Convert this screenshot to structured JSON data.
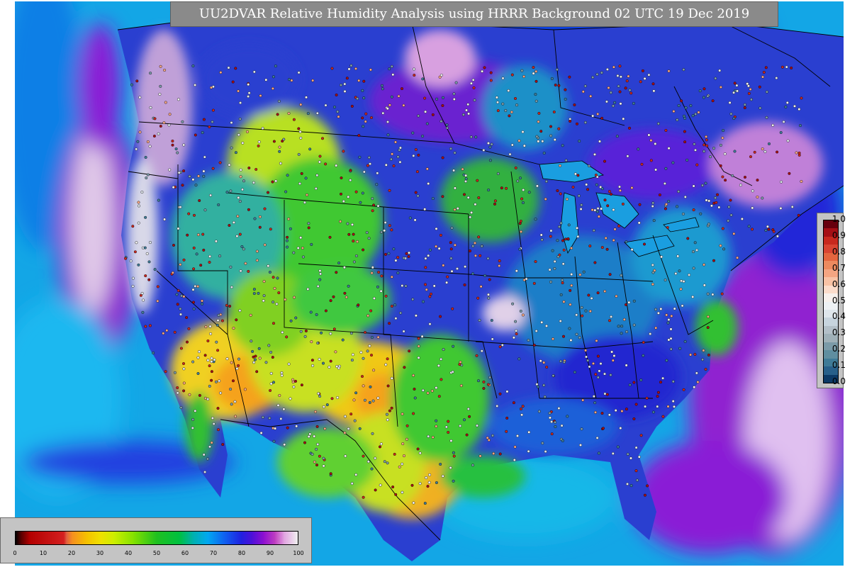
{
  "title": "UU2DVAR Relative Humidity Analysis using HRRR Background 02 UTC 19 Dec 2019",
  "colors": {
    "ocean": "#13a6e6",
    "land_wet": "#2a3fd0",
    "land_mid": "#1fc21f",
    "land_dry": "#f0e020",
    "land_very_dry": "#f5a21a",
    "moist_purple": "#8a1bd6",
    "cloud_white": "#e8e8e8",
    "border": "#000000"
  },
  "relative_humidity_colorbar": {
    "ticks": [
      "0",
      "10",
      "20",
      "30",
      "40",
      "50",
      "60",
      "70",
      "80",
      "90",
      "100"
    ],
    "stops": [
      {
        "value": 0,
        "color": "#000000"
      },
      {
        "value": 2,
        "color": "#5a0000"
      },
      {
        "value": 5,
        "color": "#b30000"
      },
      {
        "value": 17,
        "color": "#d42020"
      },
      {
        "value": 18,
        "color": "#e06040"
      },
      {
        "value": 20,
        "color": "#f59020"
      },
      {
        "value": 25,
        "color": "#f5c000"
      },
      {
        "value": 30,
        "color": "#f0e000"
      },
      {
        "value": 35,
        "color": "#ccee00"
      },
      {
        "value": 42,
        "color": "#80e000"
      },
      {
        "value": 50,
        "color": "#20c020"
      },
      {
        "value": 58,
        "color": "#00c040"
      },
      {
        "value": 63,
        "color": "#00b0b0"
      },
      {
        "value": 68,
        "color": "#00a8f0"
      },
      {
        "value": 74,
        "color": "#1060f0"
      },
      {
        "value": 80,
        "color": "#2020e0"
      },
      {
        "value": 84,
        "color": "#5010d8"
      },
      {
        "value": 88,
        "color": "#9010d0"
      },
      {
        "value": 92,
        "color": "#c040c0"
      },
      {
        "value": 95,
        "color": "#e0a0e0"
      },
      {
        "value": 100,
        "color": "#f0f0f0"
      }
    ]
  },
  "station_scale": {
    "ticks": [
      "1.0",
      "0.9",
      "0.8",
      "0.7",
      "0.6",
      "0.5",
      "0.4",
      "0.3",
      "0.2",
      "0.1",
      "0.0"
    ],
    "segments": [
      {
        "from": 0.95,
        "to": 1.0,
        "color": "#67000d"
      },
      {
        "from": 0.9,
        "to": 0.95,
        "color": "#a50f15"
      },
      {
        "from": 0.85,
        "to": 0.9,
        "color": "#c8281e"
      },
      {
        "from": 0.8,
        "to": 0.85,
        "color": "#d94432"
      },
      {
        "from": 0.75,
        "to": 0.8,
        "color": "#e4653f"
      },
      {
        "from": 0.7,
        "to": 0.75,
        "color": "#ed8a5f"
      },
      {
        "from": 0.65,
        "to": 0.7,
        "color": "#f4a582"
      },
      {
        "from": 0.6,
        "to": 0.65,
        "color": "#f8c2a5"
      },
      {
        "from": 0.55,
        "to": 0.6,
        "color": "#fbdccb"
      },
      {
        "from": 0.5,
        "to": 0.55,
        "color": "#f7f0ec"
      },
      {
        "from": 0.45,
        "to": 0.5,
        "color": "#eef1f4"
      },
      {
        "from": 0.4,
        "to": 0.45,
        "color": "#dfe6ec"
      },
      {
        "from": 0.35,
        "to": 0.4,
        "color": "#c7d4de"
      },
      {
        "from": 0.3,
        "to": 0.35,
        "color": "#b3bfc8"
      },
      {
        "from": 0.25,
        "to": 0.3,
        "color": "#9fb0b8"
      },
      {
        "from": 0.2,
        "to": 0.25,
        "color": "#7b9aa8"
      },
      {
        "from": 0.15,
        "to": 0.2,
        "color": "#5f8ea0"
      },
      {
        "from": 0.1,
        "to": 0.15,
        "color": "#3f7b97"
      },
      {
        "from": 0.05,
        "to": 0.1,
        "color": "#28608a"
      },
      {
        "from": 0.0,
        "to": 0.05,
        "color": "#0d3a66"
      }
    ]
  }
}
